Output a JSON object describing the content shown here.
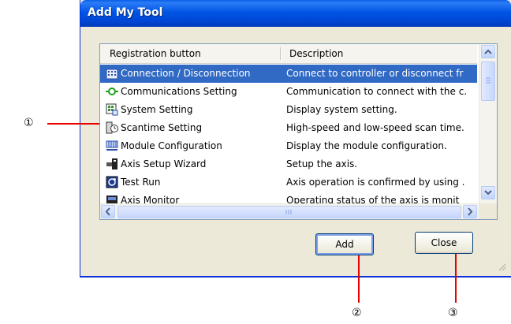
{
  "window": {
    "title": "Add My Tool"
  },
  "list": {
    "columns": [
      "Registration button",
      "Description"
    ],
    "rows": [
      {
        "name": "Connection / Disconnection",
        "description": "Connect to controller or disconnect fr",
        "icon": "connection-icon",
        "selected": true
      },
      {
        "name": "Communications Setting",
        "description": "Communication to connect with the c.",
        "icon": "communications-icon",
        "selected": false
      },
      {
        "name": "System Setting",
        "description": "Display system setting.",
        "icon": "system-setting-icon",
        "selected": false
      },
      {
        "name": "Scantime Setting",
        "description": "High-speed and low-speed scan time.",
        "icon": "scantime-icon",
        "selected": false
      },
      {
        "name": "Module Configuration",
        "description": "Display the module configuration.",
        "icon": "module-configuration-icon",
        "selected": false
      },
      {
        "name": "Axis Setup Wizard",
        "description": "Setup the axis.",
        "icon": "axis-setup-icon",
        "selected": false
      },
      {
        "name": "Test Run",
        "description": "Axis operation is confirmed by using .",
        "icon": "test-run-icon",
        "selected": false
      },
      {
        "name": "Axis Monitor",
        "description": "Operating status of the axis is monit",
        "icon": "axis-monitor-icon",
        "selected": false
      }
    ]
  },
  "buttons": {
    "add_label": "Add",
    "close_label": "Close"
  },
  "callouts": {
    "one": "①",
    "two": "②",
    "three": "③"
  },
  "colors": {
    "selection": "#316ac5",
    "titlebar": "#0055e5",
    "callout": "#e60000"
  }
}
